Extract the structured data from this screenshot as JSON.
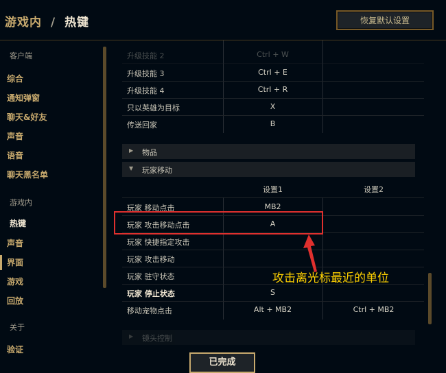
{
  "header": {
    "breadcrumb_parent": "游戏内",
    "breadcrumb_separator": "/",
    "breadcrumb_current": "热键",
    "reset_button": "恢复默认设置"
  },
  "sidebar": {
    "section_client": "客户端",
    "client_items": [
      "综合",
      "通知弹窗",
      "聊天&好友",
      "声音",
      "语音",
      "聊天黑名单"
    ],
    "section_ingame": "游戏内",
    "ingame_items": [
      "热键",
      "声音",
      "界面",
      "游戏",
      "回放"
    ],
    "section_about": "关于",
    "about_items": [
      "验证"
    ],
    "active_item": "热键"
  },
  "hotkeys_top": [
    {
      "action": "升级技能 2",
      "key": "Ctrl + W"
    },
    {
      "action": "升级技能 3",
      "key": "Ctrl + E"
    },
    {
      "action": "升级技能 4",
      "key": "Ctrl + R"
    },
    {
      "action": "只以英雄为目标",
      "key": "X"
    },
    {
      "action": "传送回家",
      "key": "B"
    }
  ],
  "sections": {
    "items": "物品",
    "player_movement": "玩家移动",
    "camera_control": "镜头控制"
  },
  "movement_table": {
    "col1": "设置1",
    "col2": "设置2",
    "rows": [
      {
        "action": "玩家 移动点击",
        "key1": "MB2",
        "key2": ""
      },
      {
        "action": "玩家 攻击移动点击",
        "key1": "A",
        "key2": ""
      },
      {
        "action": "玩家 快捷指定攻击",
        "key1": "",
        "key2": ""
      },
      {
        "action": "玩家 攻击移动",
        "key1": "",
        "key2": ""
      },
      {
        "action": "玩家 驻守状态",
        "key1": "",
        "key2": ""
      },
      {
        "action": "玩家 停止状态",
        "key1": "S",
        "key2": ""
      },
      {
        "action": "移动宠物点击",
        "key1": "Alt + MB2",
        "key2": "Ctrl + MB2"
      }
    ]
  },
  "annotation": {
    "text": "攻击离光标最近的单位",
    "color": "#ffd100",
    "box_color": "#e0302e"
  },
  "footer": {
    "done_button": "已完成"
  },
  "colors": {
    "background": "#010a13",
    "gold": "#c8aa6e",
    "gold_dark": "#785a28"
  }
}
